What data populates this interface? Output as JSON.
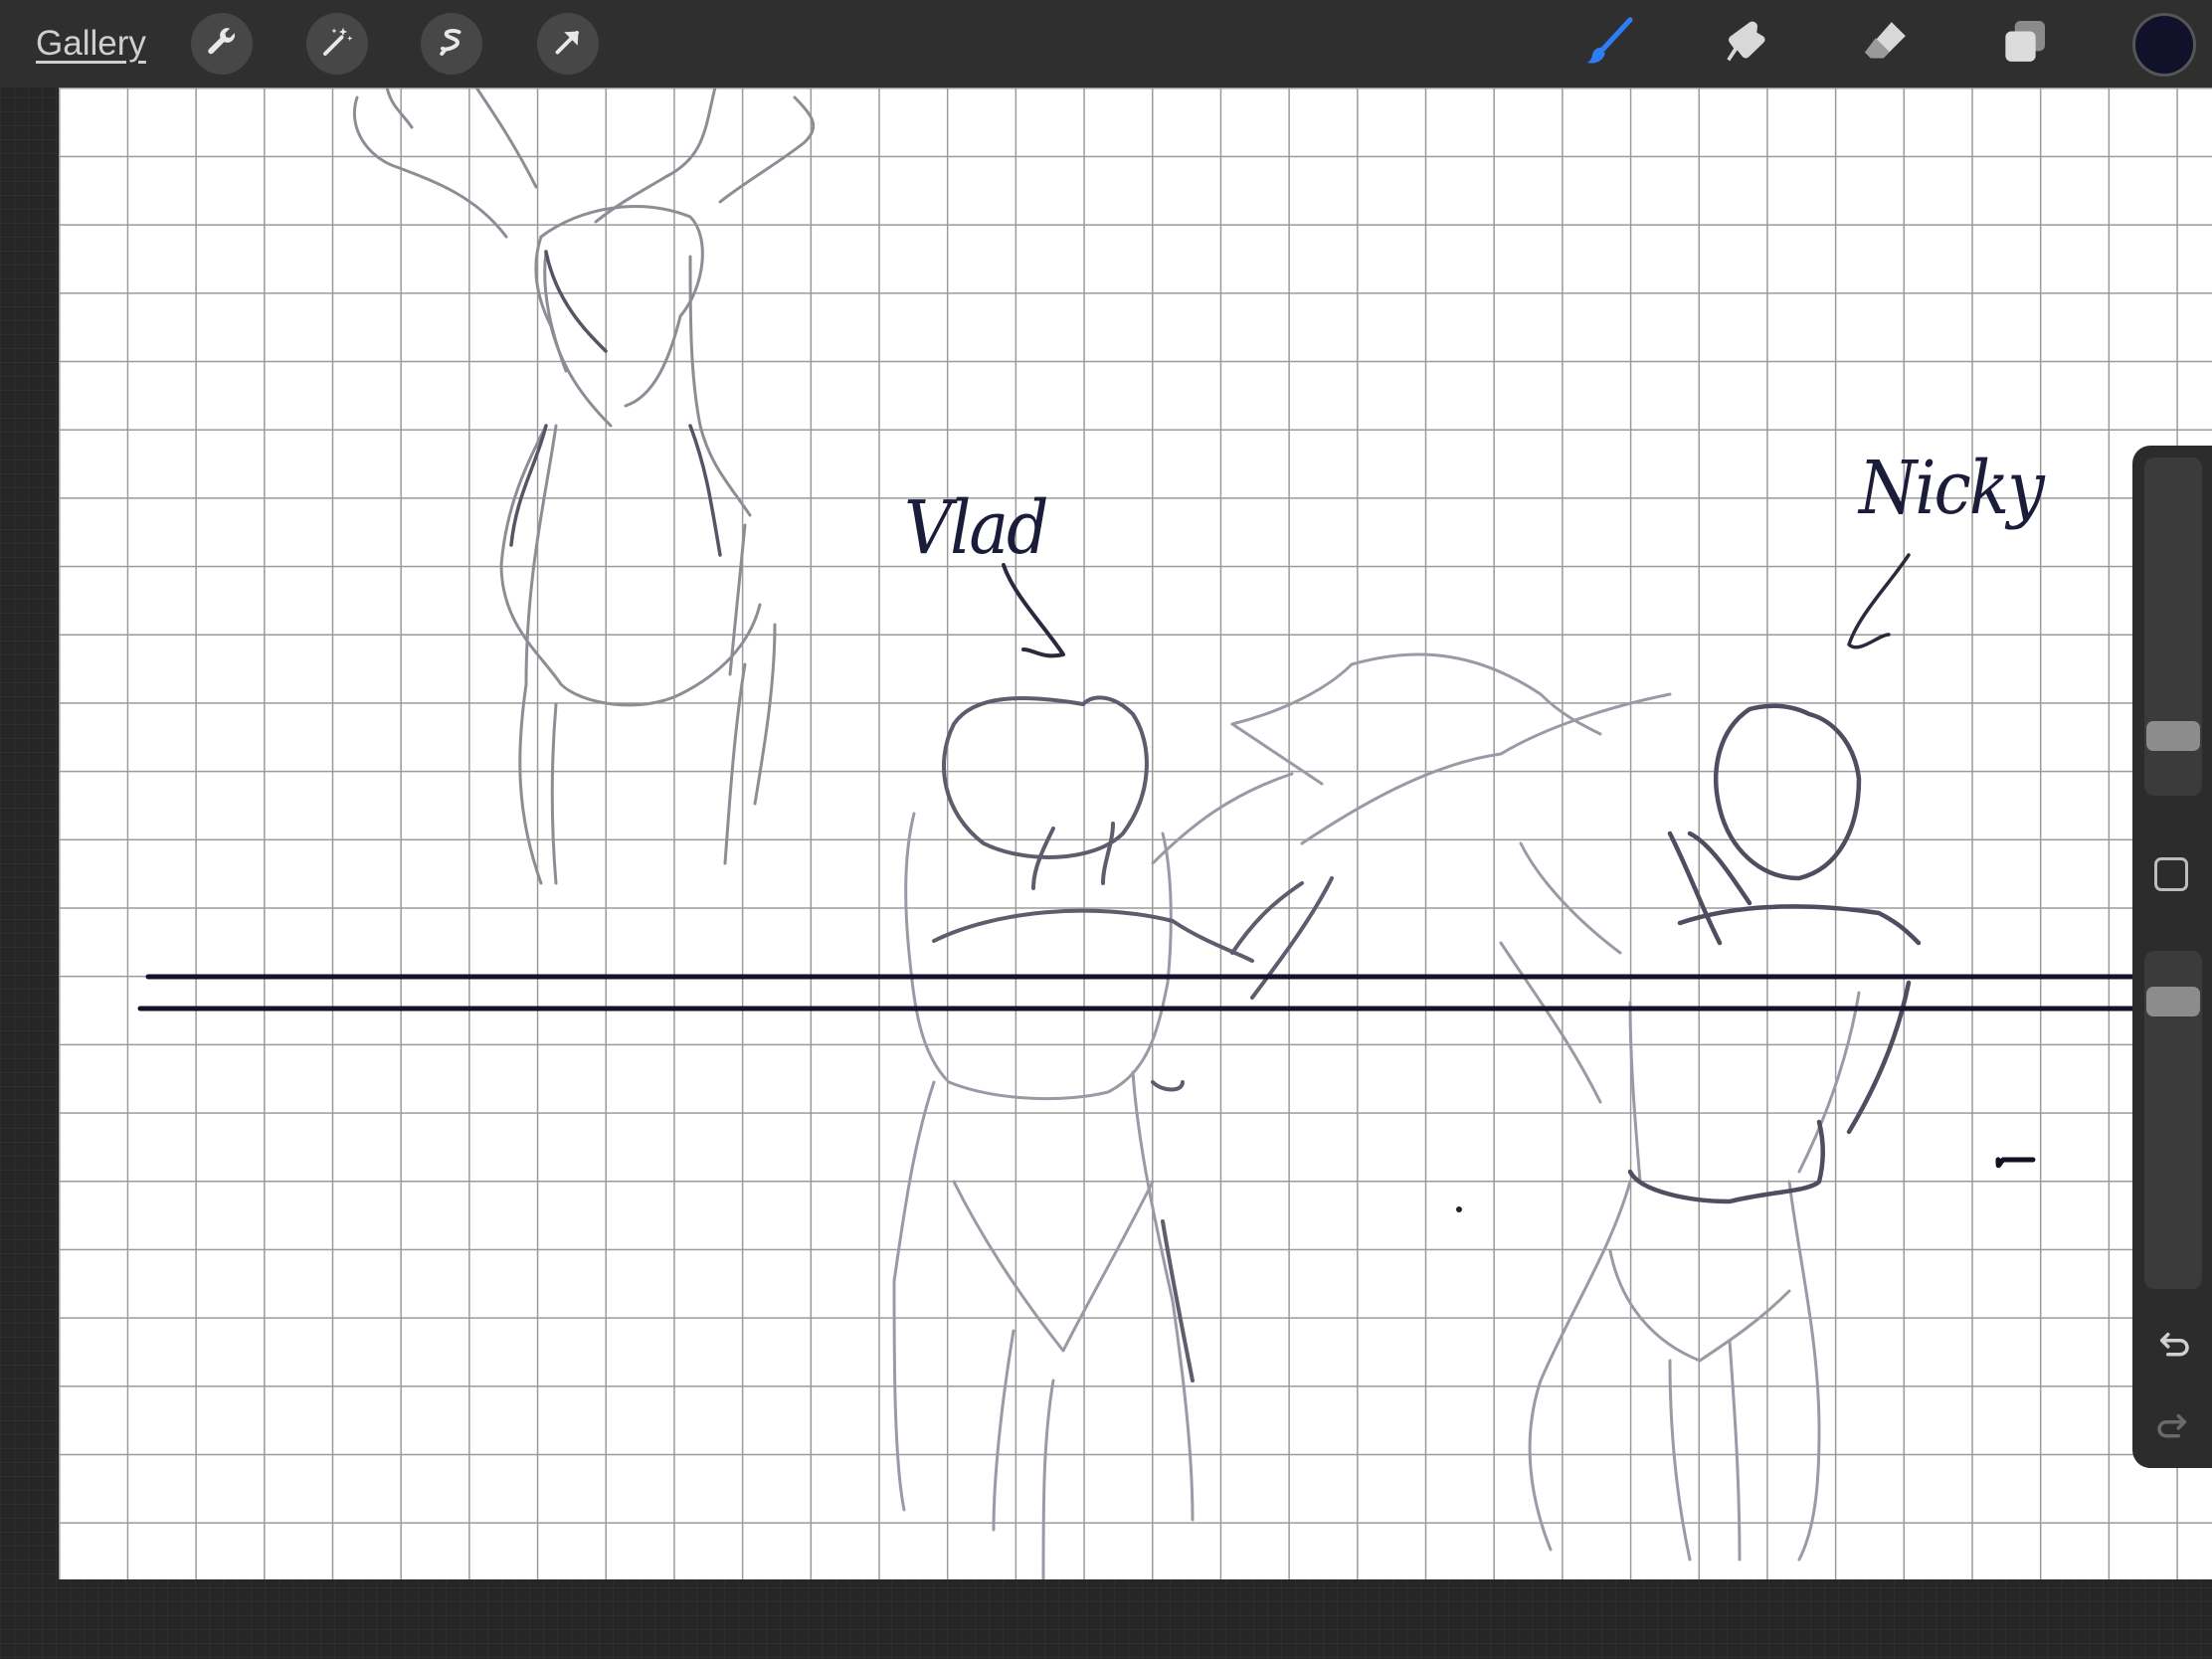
{
  "toolbar": {
    "gallery_label": "Gallery",
    "left_tools": [
      "wrench-icon",
      "magic-wand-icon",
      "selection-icon",
      "transform-arrow-icon"
    ],
    "right_tools": [
      "brush-icon",
      "smudge-icon",
      "eraser-icon",
      "layers-icon"
    ],
    "active_tool": "brush",
    "active_color": "#12112a",
    "accent_color": "#2e7cf6"
  },
  "canvas": {
    "labels": {
      "left_figure": "Vlad",
      "right_figure": "Nicky"
    }
  },
  "sidebar": {
    "brush_size_level": 0.86,
    "opacity_level": 0.11,
    "modify_button": "square-icon",
    "undo": "undo-icon",
    "redo": "redo-icon"
  }
}
